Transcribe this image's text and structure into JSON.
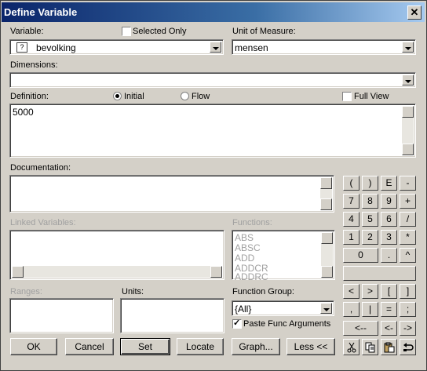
{
  "window": {
    "title": "Define Variable"
  },
  "variable": {
    "label": "Variable:",
    "badge": "?",
    "value": "bevolking"
  },
  "selected_only": {
    "label": "Selected Only",
    "checked": false
  },
  "unit": {
    "label": "Unit of Measure:",
    "value": "mensen"
  },
  "dimensions": {
    "label": "Dimensions:",
    "value": ""
  },
  "definition": {
    "label": "Definition:",
    "value": "5000",
    "initial_label": "Initial",
    "flow_label": "Flow",
    "selected": "Initial"
  },
  "full_view": {
    "label": "Full View",
    "checked": false
  },
  "documentation": {
    "label": "Documentation:",
    "value": ""
  },
  "linked_variables": {
    "label": "Linked Variables:"
  },
  "functions": {
    "label": "Functions:",
    "items": [
      "ABS",
      "ABSC",
      "ADD",
      "ADDCR",
      "ADDRC"
    ]
  },
  "ranges": {
    "label": "Ranges:"
  },
  "units": {
    "label": "Units:"
  },
  "function_group": {
    "label": "Function Group:",
    "value": "{All}"
  },
  "paste_func_args": {
    "label": "Paste Func Arguments",
    "checked": true
  },
  "keypad": {
    "row1": [
      "(",
      ")",
      "E",
      "-"
    ],
    "row2": [
      "7",
      "8",
      "9",
      "+"
    ],
    "row3": [
      "4",
      "5",
      "6",
      "/"
    ],
    "row4": [
      "1",
      "2",
      "3",
      "*"
    ],
    "row5": [
      "0",
      ".",
      "^"
    ],
    "row6": [
      "<",
      ">",
      "[",
      "]"
    ],
    "row7": [
      ",",
      "|",
      "=",
      ";"
    ],
    "row8": [
      "<--",
      "<-",
      "->"
    ]
  },
  "buttons": {
    "ok": "OK",
    "cancel": "Cancel",
    "set": "Set",
    "locate": "Locate",
    "graph": "Graph...",
    "less": "Less <<"
  },
  "edit_icons": [
    "cut-icon",
    "copy-icon",
    "paste-icon",
    "undo-icon"
  ]
}
